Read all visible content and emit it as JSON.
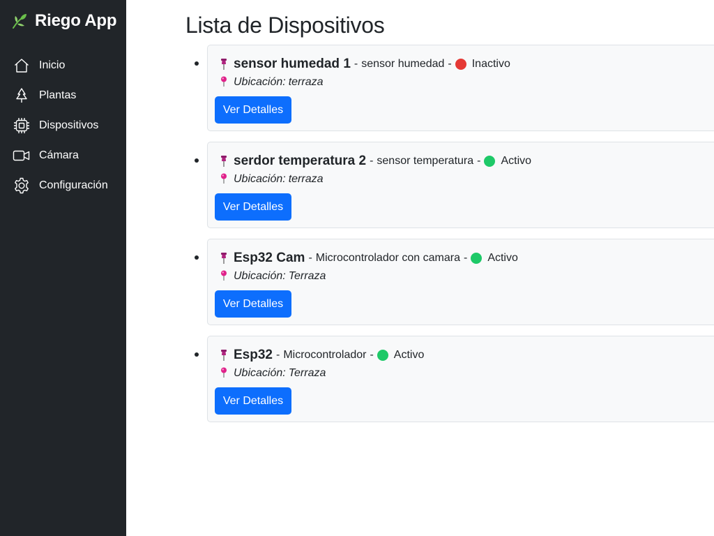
{
  "app": {
    "title": "Riego App",
    "logo_icon": "leaf-icon",
    "accent_color": "#6abf4b"
  },
  "sidebar": {
    "items": [
      {
        "label": "Inicio",
        "icon": "house-icon"
      },
      {
        "label": "Plantas",
        "icon": "tree-icon"
      },
      {
        "label": "Dispositivos",
        "icon": "cpu-icon"
      },
      {
        "label": "Cámara",
        "icon": "camera-video-icon"
      },
      {
        "label": "Configuración",
        "icon": "gear-icon"
      }
    ]
  },
  "page": {
    "title": "Lista de Dispositivos"
  },
  "devices": [
    {
      "name": "sensor humedad 1",
      "separator_1": "-",
      "type": "sensor humedad",
      "separator_2": "-",
      "status": "Inactivo",
      "status_color": "#e53935",
      "location_label": "Ubicación:",
      "location": "terraza",
      "button_label": "Ver Detalles"
    },
    {
      "name": "serdor temperatura 2",
      "separator_1": "-",
      "type": "sensor temperatura",
      "separator_2": "-",
      "status": "Activo",
      "status_color": "#1ec968",
      "location_label": "Ubicación:",
      "location": "terraza",
      "button_label": "Ver Detalles"
    },
    {
      "name": "Esp32 Cam",
      "separator_1": "-",
      "type": "Microcontrolador con camara",
      "separator_2": "-",
      "status": "Activo",
      "status_color": "#1ec968",
      "location_label": "Ubicación:",
      "location": "Terraza",
      "button_label": "Ver Detalles"
    },
    {
      "name": "Esp32",
      "separator_1": "-",
      "type": "Microcontrolador",
      "separator_2": "-",
      "status": "Activo",
      "status_color": "#1ec968",
      "location_label": "Ubicación:",
      "location": "Terraza",
      "button_label": "Ver Detalles"
    }
  ],
  "colors": {
    "sidebar_bg": "#212529",
    "button_primary": "#0d6efd",
    "card_bg": "#f8f9fa",
    "pin_color": "#e0218a"
  }
}
